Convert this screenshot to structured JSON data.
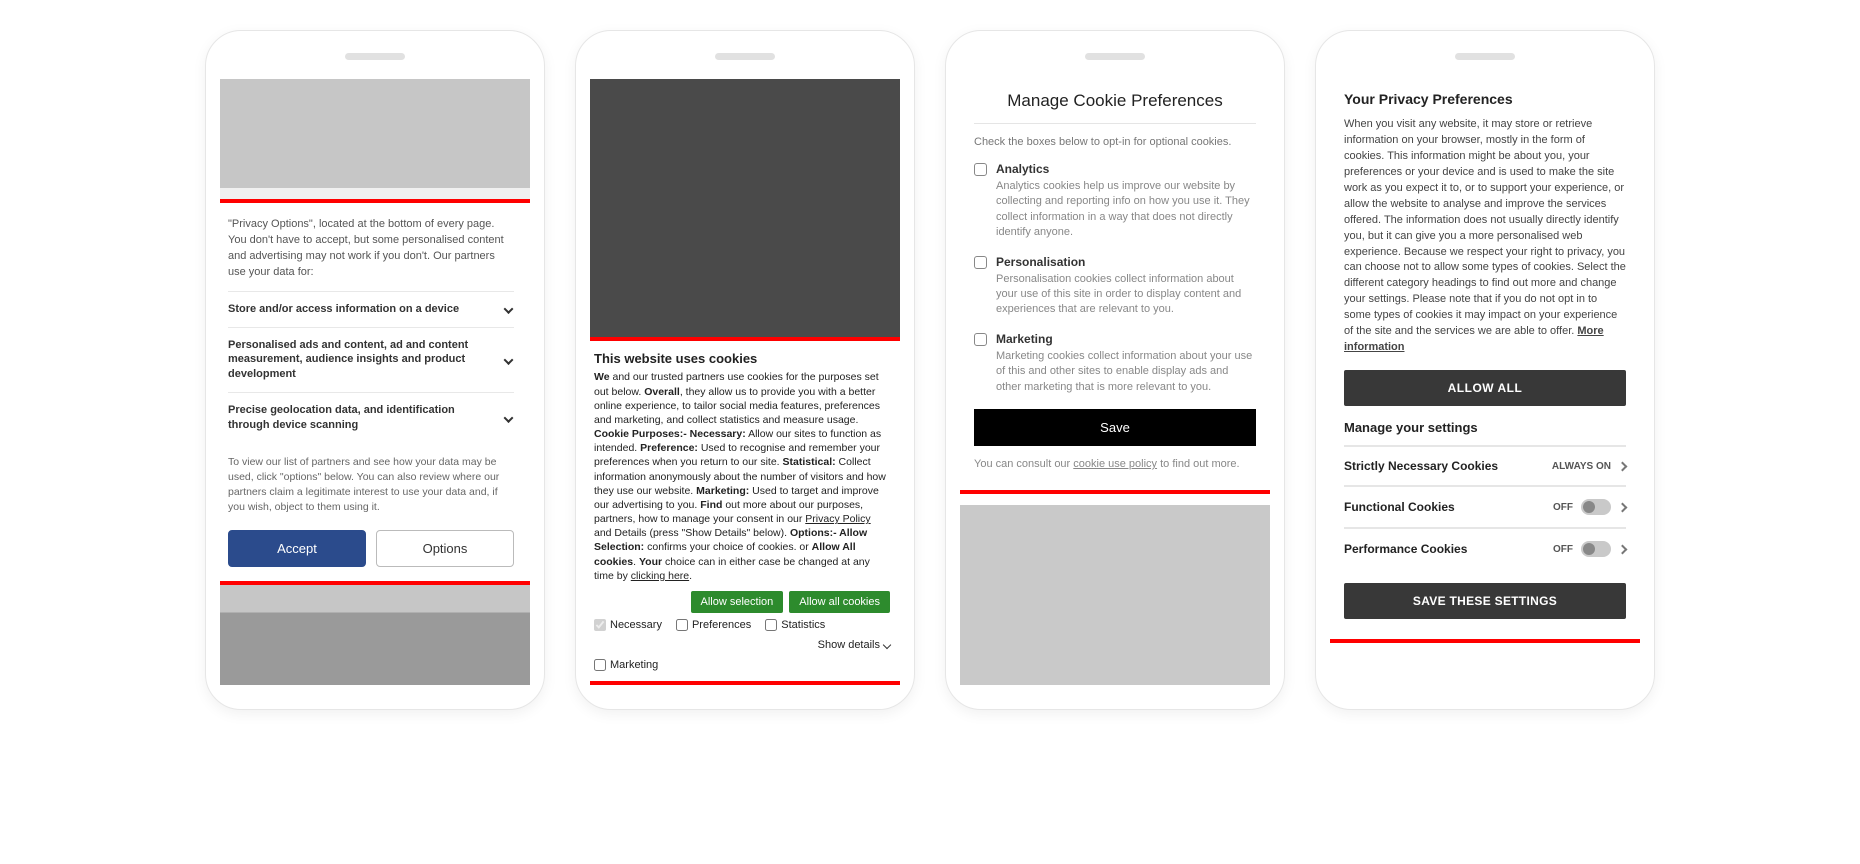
{
  "phone1": {
    "intro": "\"Privacy Options\", located at the bottom of every page. You don't have to accept, but some personalised content and advertising may not work if you don't. Our partners use your data for:",
    "rows": [
      "Store and/or access information on a device",
      "Personalised ads and content, ad and content measurement, audience insights and product development",
      "Precise geolocation data, and identification through device scanning"
    ],
    "note": "To view our list of partners and see how your data may be used, click \"options\" below. You can also review where our partners claim a legitimate interest to use your data and, if you wish, object to them using it.",
    "accept": "Accept",
    "options": "Options"
  },
  "phone2": {
    "title": "This website uses cookies",
    "parts": {
      "t0": "We",
      "t1": " and our trusted partners use cookies for the purposes set out below. ",
      "t2": "Overall",
      "t3": ", they allow us to provide you with a better online experience, to tailor social media features, preferences and marketing, and collect statistics and measure usage. ",
      "t4": "Cookie Purposes:- Necessary:",
      "t5": " Allow our sites to function as intended. ",
      "t6": "Preference:",
      "t7": " Used to recognise and remember your preferences when you return to our site. ",
      "t8": "Statistical:",
      "t9": " Collect information anonymously about the number of visitors and how they use our website. ",
      "t10": "Marketing:",
      "t11": " Used to target and improve our advertising to you. ",
      "t12": "Find",
      "t13": " out more about our purposes, partners, how to manage your consent in our ",
      "t14": "Privacy Policy",
      "t15": " and Details (press \"Show Details\" below). ",
      "t16": "Options:- Allow Selection:",
      "t17": " confirms your choice of cookies. or ",
      "t18": "Allow All cookies",
      "t19": ". ",
      "t20": "Your",
      "t21": " choice can in either case be changed at any time by ",
      "t22": "clicking here",
      "t23": "."
    },
    "allow_selection": "Allow selection",
    "allow_all": "Allow all cookies",
    "cb_necessary": "Necessary",
    "cb_preferences": "Preferences",
    "cb_statistics": "Statistics",
    "cb_marketing": "Marketing",
    "show_details": "Show details"
  },
  "phone3": {
    "title": "Manage Cookie Preferences",
    "intro": "Check the boxes below to opt-in for optional cookies.",
    "cats": [
      {
        "title": "Analytics",
        "desc": "Analytics cookies help us improve our website by collecting and reporting info on how you use it. They collect information in a way that does not directly identify anyone."
      },
      {
        "title": "Personalisation",
        "desc": "Personalisation cookies collect information about your use of this site in order to display content and experiences that are relevant to you."
      },
      {
        "title": "Marketing",
        "desc": "Marketing cookies collect information about your use of this and other sites to enable display ads and other marketing that is more relevant to you."
      }
    ],
    "save": "Save",
    "foot_pre": "You can consult our ",
    "foot_link": "cookie use policy",
    "foot_post": " to find out more."
  },
  "phone4": {
    "title": "Your Privacy Preferences",
    "body": "When you visit any website, it may store or retrieve information on your browser, mostly in the form of cookies. This information might be about you, your preferences or your device and is used to make the site work as you expect it to, or to support your experience, or allow the website to analyse and improve the services offered. The information does not usually directly identify you, but it can give you a more personalised web experience. Because we respect your right to privacy, you can choose not to allow some types of cookies. Select the different category headings to find out more and change your settings. Please note that if you do not opt in to some types of cookies it may impact on your experience of the site and the services we are able to offer.  ",
    "more": "More information",
    "allow_all": "ALLOW ALL",
    "manage": "Manage your settings",
    "settings": [
      {
        "name": "Strictly Necessary Cookies",
        "state": "ALWAYS ON",
        "toggle": false
      },
      {
        "name": "Functional Cookies",
        "state": "OFF",
        "toggle": true
      },
      {
        "name": "Performance Cookies",
        "state": "OFF",
        "toggle": true
      }
    ],
    "save": "SAVE THESE SETTINGS"
  }
}
